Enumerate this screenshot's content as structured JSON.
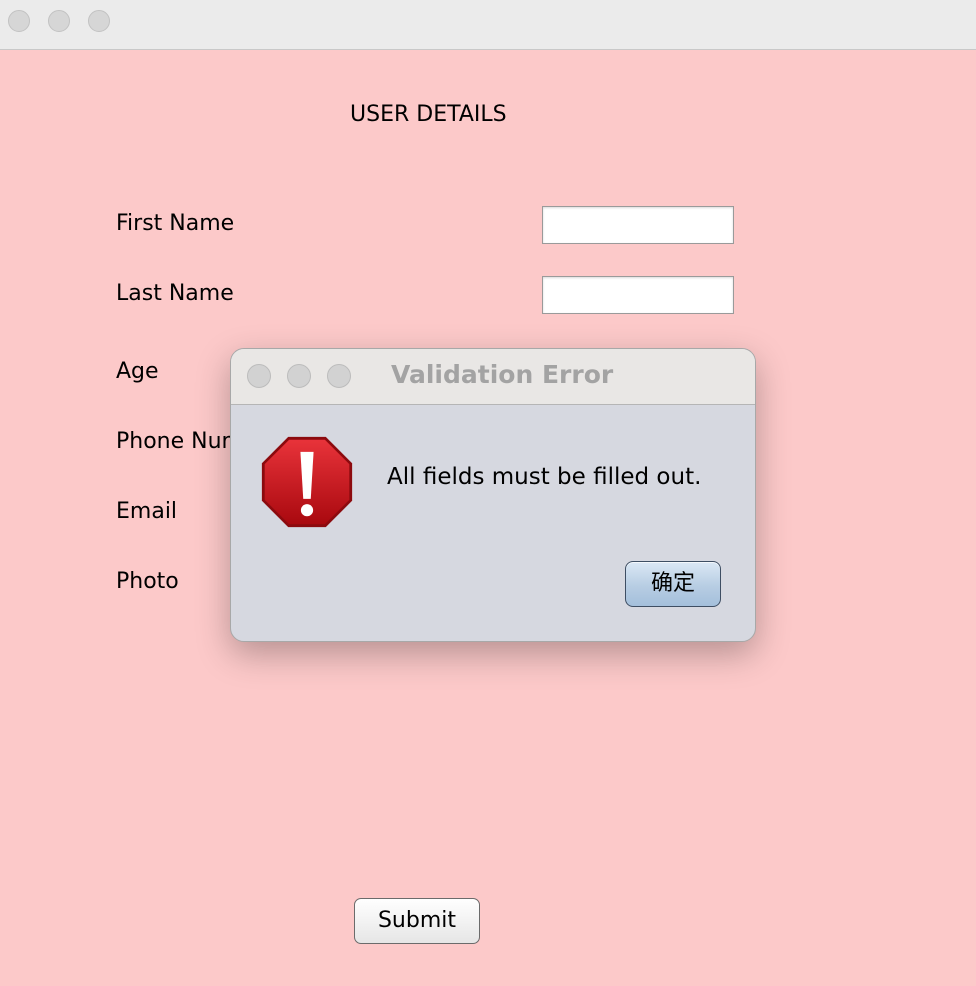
{
  "window": {
    "traffic_lights": [
      "close-button",
      "minimize-button",
      "zoom-button"
    ]
  },
  "form": {
    "title": "USER DETAILS",
    "labels": {
      "first_name": "First Name",
      "last_name": "Last Name",
      "age": "Age",
      "phone": "Phone Number",
      "email": "Email",
      "photo": "Photo"
    },
    "fields": {
      "first_name": "",
      "last_name": ""
    },
    "submit_label": "Submit"
  },
  "dialog": {
    "title": "Validation Error",
    "message": "All fields must be filled out.",
    "ok_label": "确定",
    "icon": "error-stop-icon"
  },
  "colors": {
    "background": "#fcc9c9",
    "dialog_background": "#d6d8e0",
    "error_red": "#c8161c"
  }
}
